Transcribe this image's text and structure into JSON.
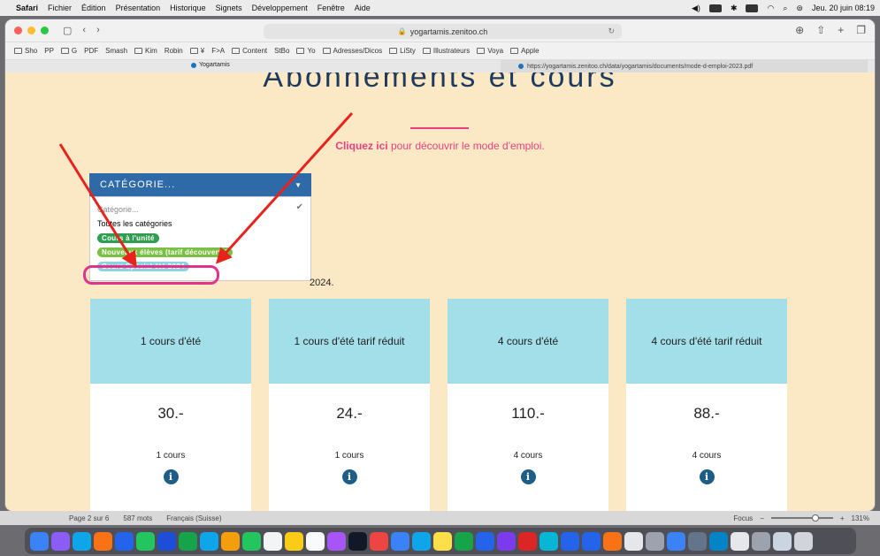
{
  "menubar": {
    "apple": "",
    "items": [
      "Safari",
      "Fichier",
      "Édition",
      "Présentation",
      "Historique",
      "Signets",
      "Développement",
      "Fenêtre",
      "Aide"
    ],
    "clock": "Jeu. 20 juin 08:19"
  },
  "browser": {
    "url": "yogartamis.zenitoo.ch",
    "bookmarks": [
      "Sho",
      "PP",
      "G",
      "PDF",
      "Smash",
      "Kim",
      "Robin",
      "¥",
      "F>A",
      "Content",
      "StBo",
      "Yo",
      "Adresses/Dicos",
      "LiSty",
      "Illustrateurs",
      "Voya",
      "Apple"
    ],
    "tab_active": "Yogartamis",
    "tab_other": "https://yogartamis.zenitoo.ch/data/yogartamis/documents/mode-d-emploi-2023.pdf"
  },
  "page": {
    "heading": "Abonnements et cours",
    "cta_bold": "Cliquez ici",
    "cta_rest": " pour découvrir le mode d'emploi.",
    "subtext": "2024.",
    "dropdown": {
      "label": "CATÉGORIE...",
      "options": [
        {
          "label": "Catégorie...",
          "style": "gray"
        },
        {
          "label": "Toutes les catégories",
          "style": "plain"
        },
        {
          "label": "Cours à l'unité",
          "style": "pill",
          "color": "#2e9e4f"
        },
        {
          "label": "Nouveaux élèves (tarif découverte)",
          "style": "pill",
          "color": "#7ac043"
        },
        {
          "label": "Cours Spécial été 2024",
          "style": "pill",
          "color": "#8fd3e0"
        }
      ]
    },
    "cards": [
      {
        "title": "1 cours d'été",
        "price": "30.-",
        "count": "1 cours"
      },
      {
        "title": "1 cours d'été tarif réduit",
        "price": "24.-",
        "count": "1 cours"
      },
      {
        "title": "4 cours d'été",
        "price": "110.-",
        "count": "4 cours"
      },
      {
        "title": "4 cours d'été tarif réduit",
        "price": "88.-",
        "count": "4 cours"
      }
    ]
  },
  "statusbar": {
    "page": "Page 2 sur 6",
    "words": "587 mots",
    "lang": "Français (Suisse)",
    "focus": "Focus",
    "zoom": "131%"
  },
  "colors": {
    "accent_pink": "#e8417f",
    "arrow_red": "#e8231c",
    "card_top": "#a3dfe8",
    "dropdown_blue": "#2f6aa8"
  }
}
